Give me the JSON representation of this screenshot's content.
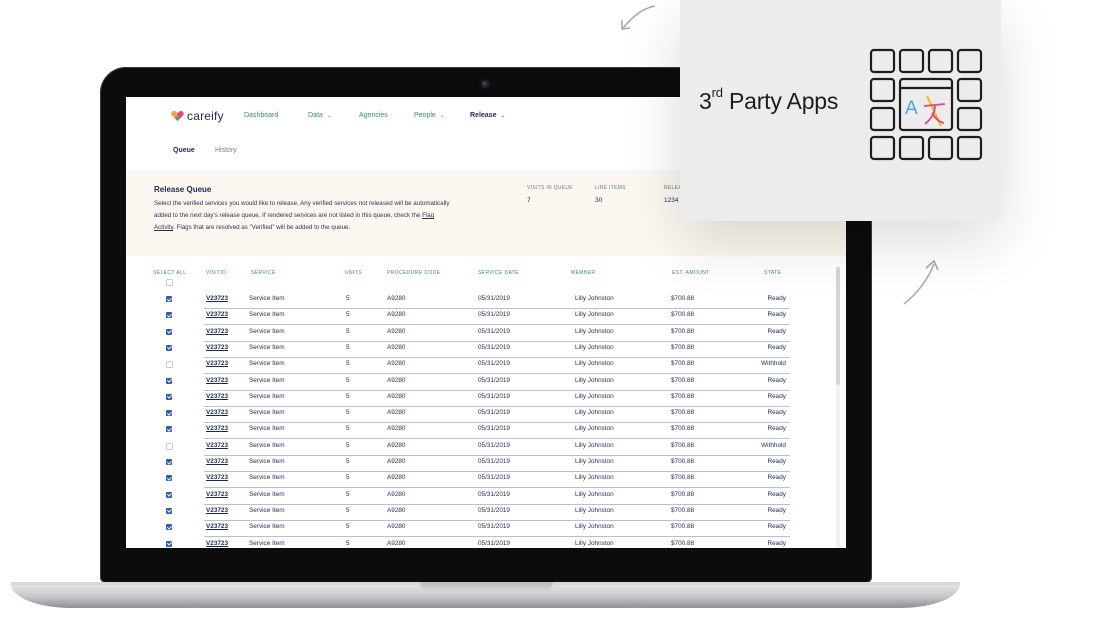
{
  "app": {
    "logo": "careify",
    "nav": [
      {
        "label": "Dashboard",
        "dropdown": false
      },
      {
        "label": "Data",
        "dropdown": true
      },
      {
        "label": "Agencies",
        "dropdown": false
      },
      {
        "label": "People",
        "dropdown": true
      },
      {
        "label": "Release",
        "dropdown": true
      }
    ],
    "subtabs": [
      "Queue",
      "History"
    ],
    "banner": {
      "title": "Release Queue",
      "desc_1": "Select the verified services you would like to release. Any verified services not released will be automatically added to the next day's release queue. If rendered services are not listed in this queue, check the ",
      "desc_link": "Flag Activity",
      "desc_2": ". Flags that are resolved as \"Verified\" will be added to the queue.",
      "stats": [
        {
          "label": "VISITS IN QUEUE",
          "value": "7"
        },
        {
          "label": "LINE ITEMS",
          "value": "30"
        },
        {
          "label": "RELEA",
          "value": "1234"
        }
      ]
    },
    "table": {
      "headers": {
        "select_all": "SELECT ALL",
        "visit": "VISITID",
        "service": "SERVICE",
        "units": "UNITS",
        "procedure": "PROCEDURE CODE",
        "date": "SERVICE DATE",
        "member": "MEMBER",
        "amount": "EST. AMOUNT",
        "state": "STATE"
      },
      "rows": [
        {
          "checked": true,
          "visit": "V23723",
          "service": "Service Item",
          "units": "5",
          "procedure": "A9280",
          "date": "05/31/2019",
          "member": "Lilly Johnston",
          "amount": "$700.88",
          "state": "Ready"
        },
        {
          "checked": true,
          "visit": "V23723",
          "service": "Service Item",
          "units": "5",
          "procedure": "A9280",
          "date": "05/31/2019",
          "member": "Lilly Johnston",
          "amount": "$700.88",
          "state": "Ready"
        },
        {
          "checked": true,
          "visit": "V23723",
          "service": "Service Item",
          "units": "5",
          "procedure": "A9280",
          "date": "05/31/2019",
          "member": "Lilly Johnston",
          "amount": "$700.88",
          "state": "Ready"
        },
        {
          "checked": true,
          "visit": "V23723",
          "service": "Service Item",
          "units": "5",
          "procedure": "A9280",
          "date": "05/31/2019",
          "member": "Lilly Johnston",
          "amount": "$700.88",
          "state": "Ready"
        },
        {
          "checked": false,
          "visit": "V23723",
          "service": "Service Item",
          "units": "5",
          "procedure": "A9280",
          "date": "05/31/2019",
          "member": "Lilly Johnston",
          "amount": "$700.88",
          "state": "Withhold"
        },
        {
          "checked": true,
          "visit": "V23723",
          "service": "Service Item",
          "units": "5",
          "procedure": "A9280",
          "date": "05/31/2019",
          "member": "Lilly Johnston",
          "amount": "$700.88",
          "state": "Ready"
        },
        {
          "checked": true,
          "visit": "V23723",
          "service": "Service Item",
          "units": "5",
          "procedure": "A9280",
          "date": "05/31/2019",
          "member": "Lilly Johnston",
          "amount": "$700.88",
          "state": "Ready"
        },
        {
          "checked": true,
          "visit": "V23723",
          "service": "Service Item",
          "units": "5",
          "procedure": "A9280",
          "date": "05/31/2019",
          "member": "Lilly Johnston",
          "amount": "$700.88",
          "state": "Ready"
        },
        {
          "checked": true,
          "visit": "V23723",
          "service": "Service Item",
          "units": "5",
          "procedure": "A9280",
          "date": "05/31/2019",
          "member": "Lilly Johnston",
          "amount": "$700.88",
          "state": "Ready"
        },
        {
          "checked": false,
          "visit": "V23723",
          "service": "Service Item",
          "units": "5",
          "procedure": "A9280",
          "date": "05/31/2019",
          "member": "Lilly Johnston",
          "amount": "$700.88",
          "state": "Withhold"
        },
        {
          "checked": true,
          "visit": "V23723",
          "service": "Service Item",
          "units": "5",
          "procedure": "A9280",
          "date": "05/31/2019",
          "member": "Lilly Johnston",
          "amount": "$700.88",
          "state": "Ready"
        },
        {
          "checked": true,
          "visit": "V23723",
          "service": "Service Item",
          "units": "5",
          "procedure": "A9280",
          "date": "05/31/2019",
          "member": "Lilly Johnston",
          "amount": "$700.88",
          "state": "Ready"
        },
        {
          "checked": true,
          "visit": "V23723",
          "service": "Service Item",
          "units": "5",
          "procedure": "A9280",
          "date": "05/31/2019",
          "member": "Lilly Johnston",
          "amount": "$700.88",
          "state": "Ready"
        },
        {
          "checked": true,
          "visit": "V23723",
          "service": "Service Item",
          "units": "5",
          "procedure": "A9280",
          "date": "05/31/2019",
          "member": "Lilly Johnston",
          "amount": "$700.88",
          "state": "Ready"
        },
        {
          "checked": true,
          "visit": "V23723",
          "service": "Service Item",
          "units": "5",
          "procedure": "A9280",
          "date": "05/31/2019",
          "member": "Lilly Johnston",
          "amount": "$700.88",
          "state": "Ready"
        },
        {
          "checked": true,
          "visit": "V23723",
          "service": "Service Item",
          "units": "5",
          "procedure": "A9280",
          "date": "05/31/2019",
          "member": "Lilly Johnston",
          "amount": "$700.88",
          "state": "Ready"
        }
      ]
    }
  },
  "card": {
    "title_num": "3",
    "title_sup": "rd",
    "title_rest": " Party Apps",
    "icon": "app-grid-translate-icon"
  },
  "colors": {
    "brand_navy": "#1c2b4f",
    "teal": "#3a8a86",
    "checkbox_blue": "#2f5fb3",
    "banner_bg": "#fdf7f1"
  }
}
